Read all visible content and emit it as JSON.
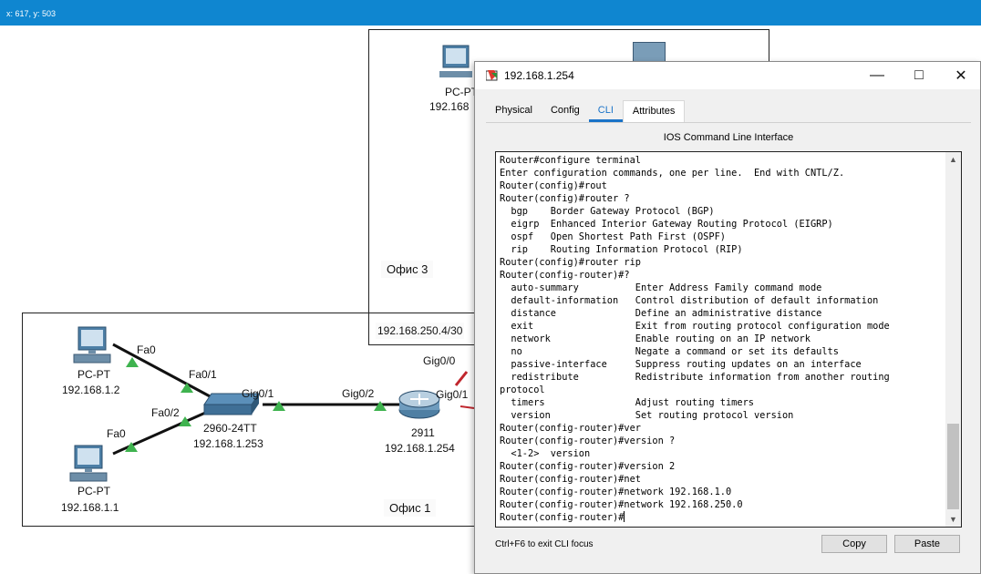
{
  "coords": "x: 617, y: 503",
  "workspace": {
    "areas": {
      "office3_label": "Офис 3",
      "office1_label": "Офис 1",
      "network_label": "192.168.250.4/30"
    },
    "devices": {
      "pc_top_name": "PC-PT",
      "pc_top_ip": "192.168",
      "pc1_name": "PC-PT",
      "pc1_ip": "192.168.1.2",
      "pc2_name": "PC-PT",
      "pc2_ip": "192.168.1.1",
      "switch_name": "2960-24TT",
      "switch_ip": "192.168.1.253",
      "router_name": "2911",
      "router_ip": "192.168.1.254"
    },
    "ports": {
      "pc1_fa0": "Fa0",
      "sw_fa01": "Fa0/1",
      "sw_fa02": "Fa0/2",
      "pc2_fa0": "Fa0",
      "sw_gig01": "Gig0/1",
      "r_gig02": "Gig0/2",
      "r_gig00": "Gig0/0",
      "r_gig01": "Gig0/1"
    }
  },
  "dialog": {
    "title": "192.168.1.254",
    "tabs": [
      "Physical",
      "Config",
      "CLI",
      "Attributes"
    ],
    "active_tab": "CLI",
    "heading": "IOS Command Line Interface",
    "cli_lines": [
      "Router#configure terminal",
      "Enter configuration commands, one per line.  End with CNTL/Z.",
      "Router(config)#rout",
      "Router(config)#router ?",
      "  bgp    Border Gateway Protocol (BGP)",
      "  eigrp  Enhanced Interior Gateway Routing Protocol (EIGRP)",
      "  ospf   Open Shortest Path First (OSPF)",
      "  rip    Routing Information Protocol (RIP)",
      "Router(config)#router rip",
      "Router(config-router)#?",
      "  auto-summary          Enter Address Family command mode",
      "  default-information   Control distribution of default information",
      "  distance              Define an administrative distance",
      "  exit                  Exit from routing protocol configuration mode",
      "  network               Enable routing on an IP network",
      "  no                    Negate a command or set its defaults",
      "  passive-interface     Suppress routing updates on an interface",
      "  redistribute          Redistribute information from another routing",
      "protocol",
      "  timers                Adjust routing timers",
      "  version               Set routing protocol version",
      "Router(config-router)#ver",
      "Router(config-router)#version ?",
      "  <1-2>  version",
      "Router(config-router)#version 2",
      "Router(config-router)#net",
      "Router(config-router)#network 192.168.1.0",
      "Router(config-router)#network 192.168.250.0",
      "Router(config-router)#"
    ],
    "hint": "Ctrl+F6 to exit CLI focus",
    "copy_label": "Copy",
    "paste_label": "Paste"
  },
  "colors": {
    "coord_bar": "#0f86d0",
    "tab_active": "#1a73c8",
    "link_up": "#3fb34f"
  },
  "icons": [
    "pc-icon",
    "switch-icon",
    "router-icon",
    "packet-tracer-icon",
    "minimize-icon",
    "maximize-icon",
    "close-icon"
  ]
}
